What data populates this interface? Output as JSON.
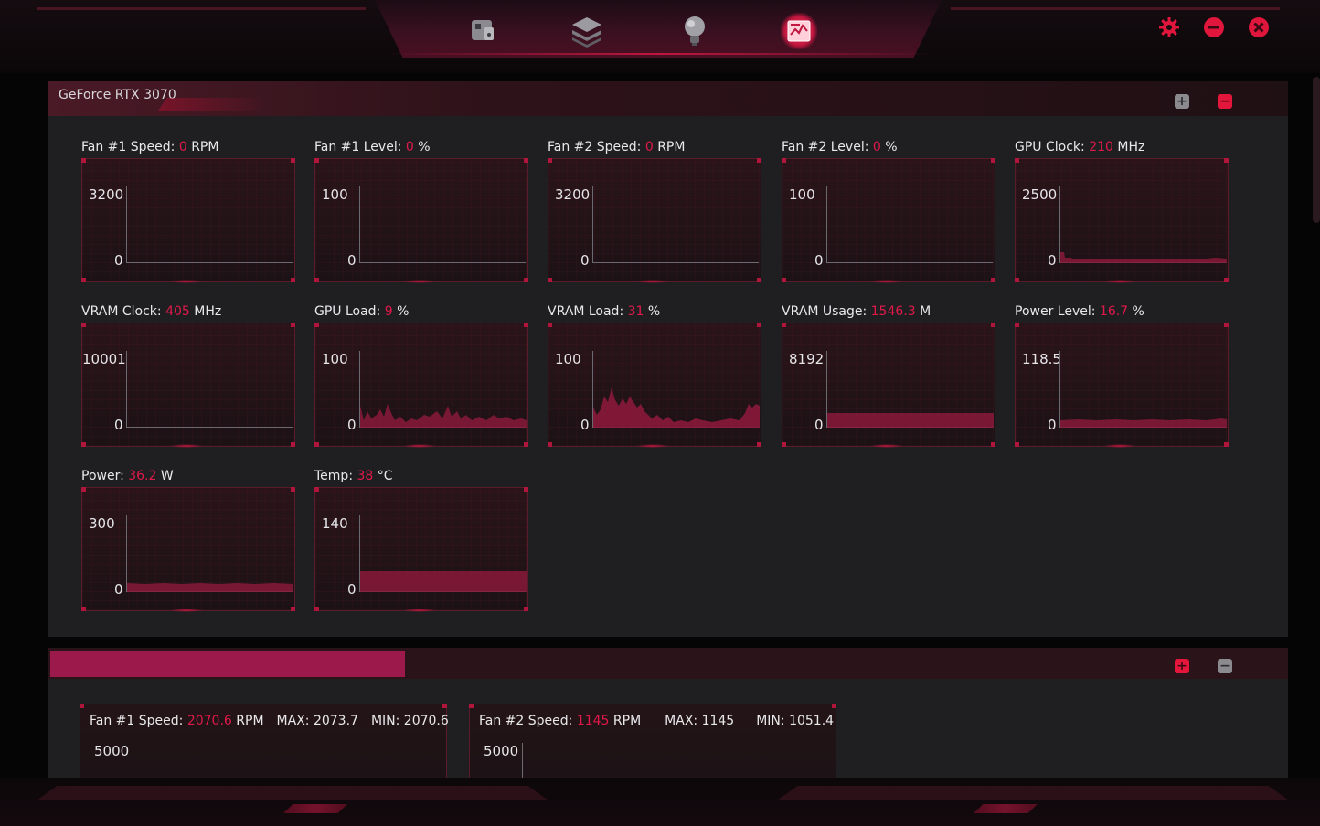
{
  "nav": {
    "icons": [
      "gamepad-icon",
      "layers-icon",
      "lightbulb-icon",
      "monitor-chart-icon"
    ],
    "active_index": 3
  },
  "window_controls": [
    "settings-icon",
    "minimize-icon",
    "close-icon"
  ],
  "colors": {
    "accent": "#e0194a",
    "panel_bg": "#1f1f21",
    "graph_border": "#5a1c2b",
    "selected_bar": "#9b1a4b"
  },
  "gpu_panel": {
    "title": "GeForce RTX 3070",
    "expand_label": "+",
    "collapse_label": "−",
    "tiles": [
      {
        "name": "Fan #1 Speed",
        "value": "0",
        "unit": "RPM",
        "ymax": "3200",
        "ymin": "0"
      },
      {
        "name": "Fan #1 Level",
        "value": "0",
        "unit": "%",
        "ymax": "100",
        "ymin": "0"
      },
      {
        "name": "Fan #2 Speed",
        "value": "0",
        "unit": "RPM",
        "ymax": "3200",
        "ymin": "0"
      },
      {
        "name": "Fan #2 Level",
        "value": "0",
        "unit": "%",
        "ymax": "100",
        "ymin": "0"
      },
      {
        "name": "GPU Clock",
        "value": "210",
        "unit": "MHz",
        "ymax": "2500",
        "ymin": "0"
      },
      {
        "name": "VRAM Clock",
        "value": "405",
        "unit": "MHz",
        "ymax": "10001",
        "ymin": "0"
      },
      {
        "name": "GPU Load",
        "value": "9",
        "unit": "%",
        "ymax": "100",
        "ymin": "0"
      },
      {
        "name": "VRAM Load",
        "value": "31",
        "unit": "%",
        "ymax": "100",
        "ymin": "0"
      },
      {
        "name": "VRAM Usage",
        "value": "1546.3",
        "unit": "M",
        "ymax": "8192",
        "ymin": "0"
      },
      {
        "name": "Power Level",
        "value": "16.7",
        "unit": "%",
        "ymax": "118.5",
        "ymin": "0"
      },
      {
        "name": "Power",
        "value": "36.2",
        "unit": "W",
        "ymax": "300",
        "ymin": "0"
      },
      {
        "name": "Temp",
        "value": "38",
        "unit": "°C",
        "ymax": "140",
        "ymin": "0"
      }
    ]
  },
  "fan_panel": {
    "expand_label": "+",
    "collapse_label": "−",
    "cards": [
      {
        "name": "Fan #1 Speed",
        "value": "2070.6",
        "unit": "RPM",
        "max_label": "MAX: 2073.7",
        "min_label": "MIN: 2070.6",
        "ymax": "5000"
      },
      {
        "name": "Fan #2 Speed",
        "value": "1145",
        "unit": "RPM",
        "max_label": "MAX: 1145",
        "min_label": "MIN: 1051.4",
        "ymax": "5000"
      }
    ]
  }
}
